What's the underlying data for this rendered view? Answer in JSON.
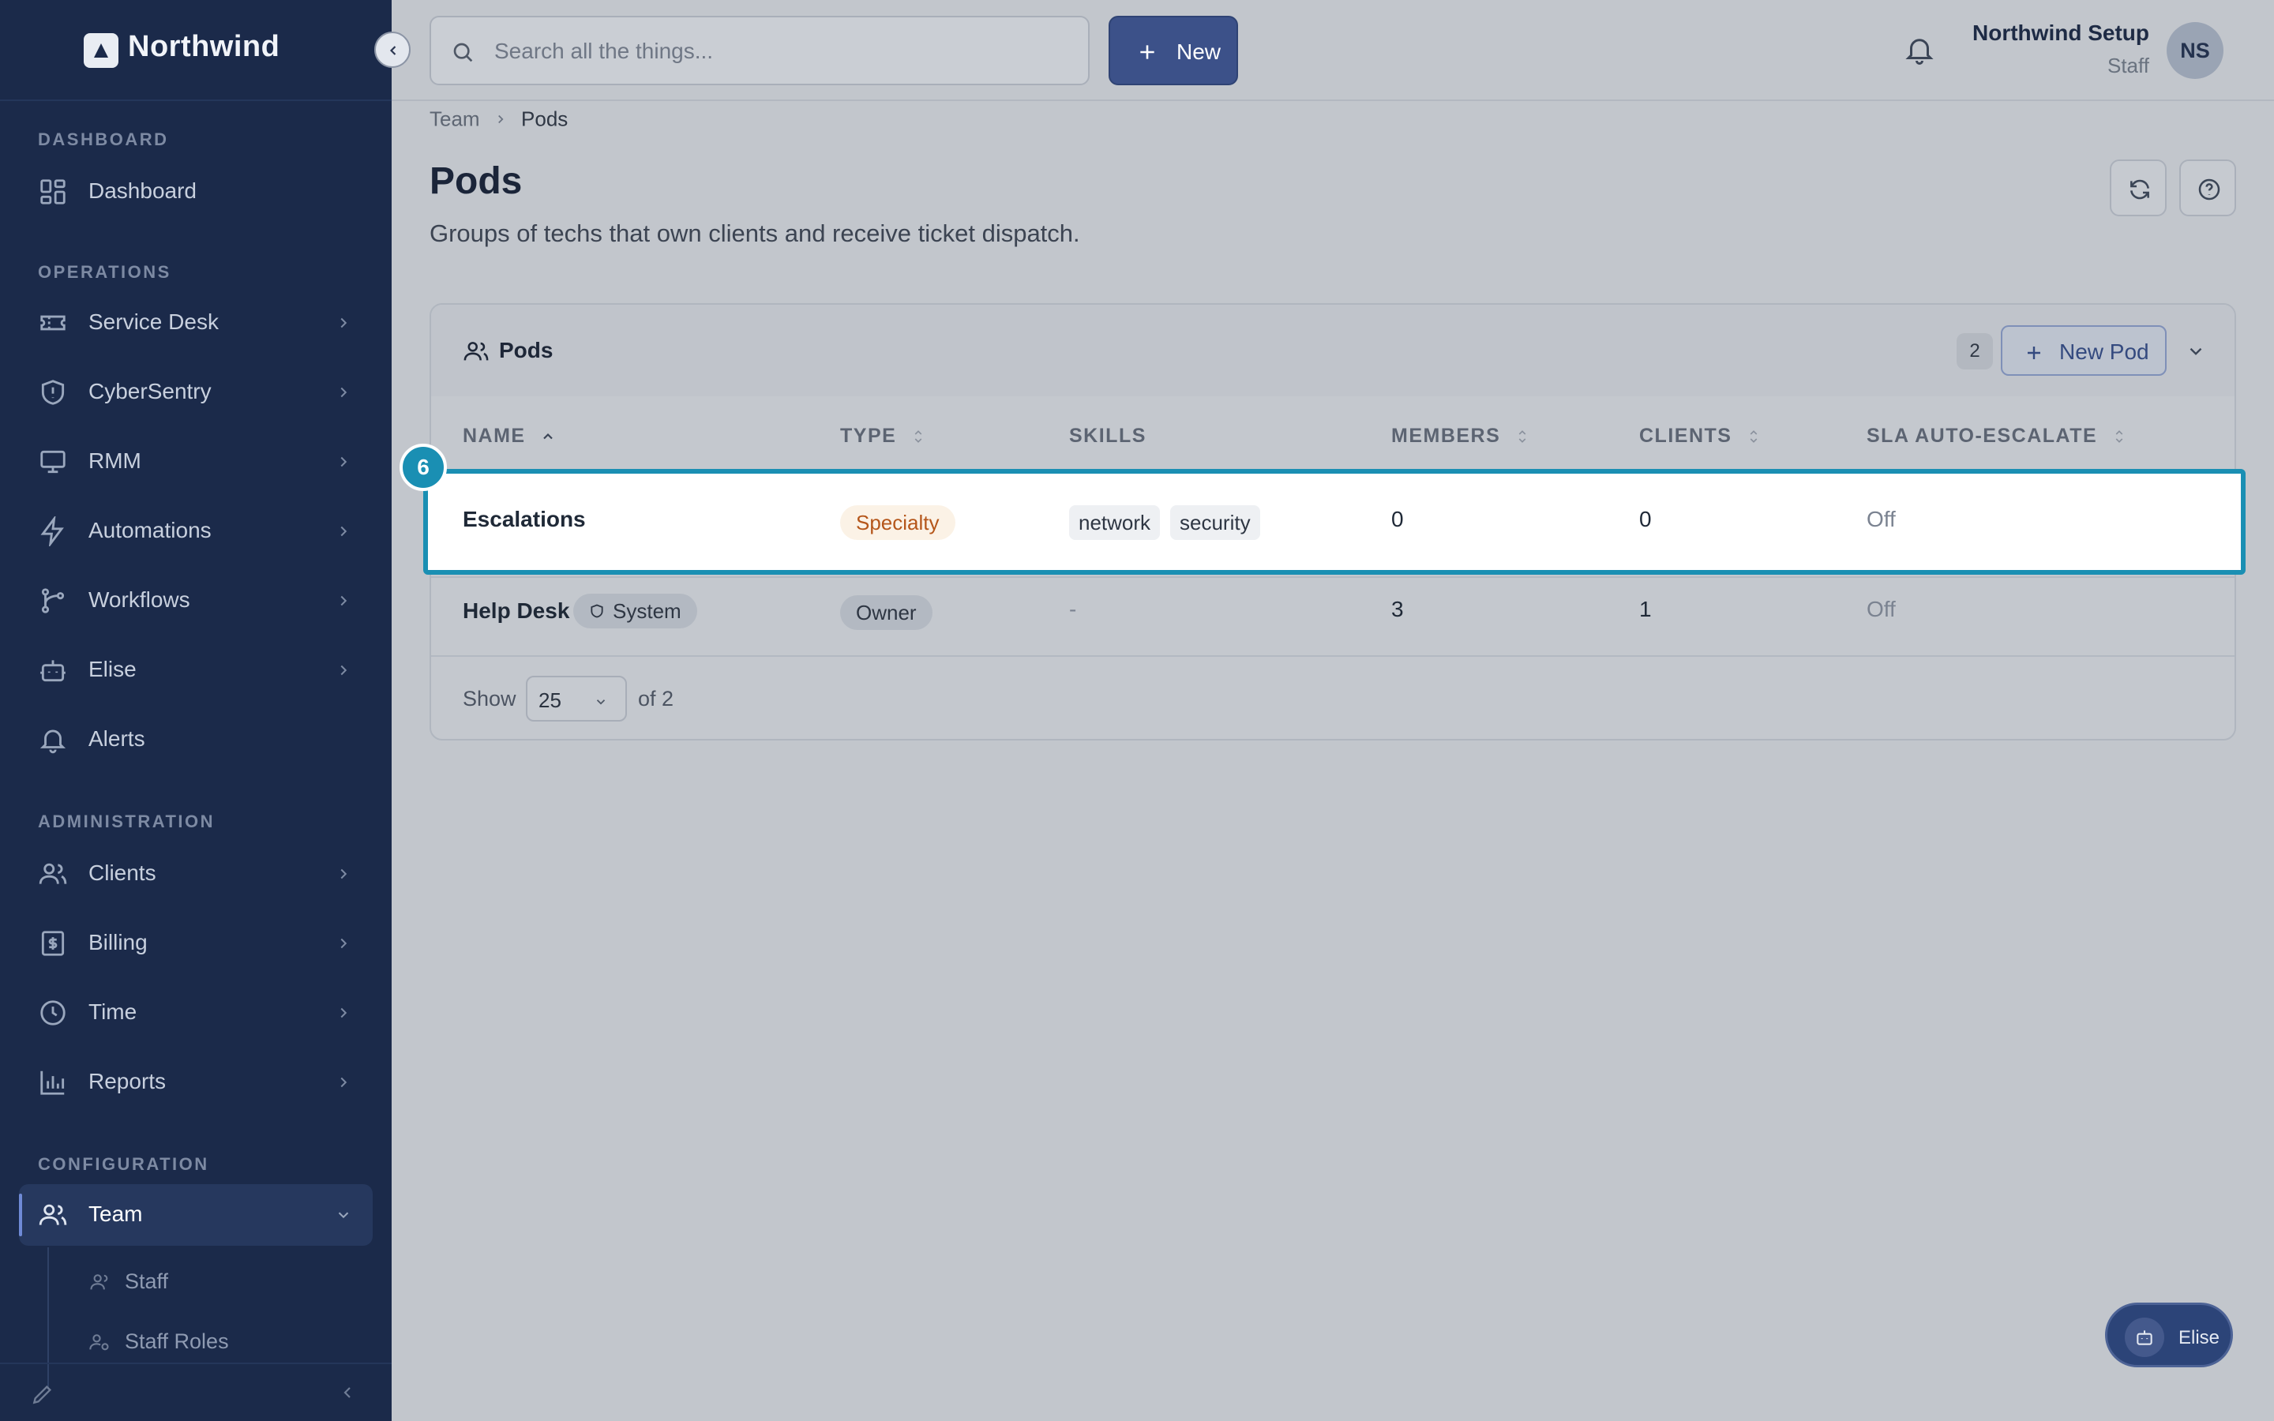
{
  "brand": {
    "name": "Northwind"
  },
  "sidebar": {
    "sections": {
      "dashboard": "DASHBOARD",
      "operations": "OPERATIONS",
      "administration": "ADMINISTRATION",
      "configuration": "CONFIGURATION"
    },
    "items": [
      {
        "label": "Dashboard"
      },
      {
        "label": "Service Desk"
      },
      {
        "label": "CyberSentry"
      },
      {
        "label": "RMM"
      },
      {
        "label": "Automations"
      },
      {
        "label": "Workflows"
      },
      {
        "label": "Elise"
      },
      {
        "label": "Alerts"
      },
      {
        "label": "Clients"
      },
      {
        "label": "Billing"
      },
      {
        "label": "Time"
      },
      {
        "label": "Reports"
      },
      {
        "label": "Team",
        "active": true
      }
    ],
    "sub_items": [
      {
        "label": "Staff"
      },
      {
        "label": "Staff Roles"
      }
    ]
  },
  "topbar": {
    "search_placeholder": "Search all the things...",
    "new_label": "New",
    "user_name": "Northwind Setup",
    "user_role": "Staff",
    "avatar_initials": "NS"
  },
  "breadcrumb": {
    "parent": "Team",
    "current": "Pods"
  },
  "page": {
    "title": "Pods",
    "subtitle": "Groups of techs that own clients and receive ticket dispatch."
  },
  "card": {
    "title": "Pods",
    "count": "2",
    "new_pod_label": "New Pod",
    "columns": {
      "name": "NAME",
      "type": "TYPE",
      "skills": "SKILLS",
      "members": "MEMBERS",
      "clients": "CLIENTS",
      "sla": "SLA AUTO-ESCALATE"
    },
    "rows": [
      {
        "name": "Escalations",
        "type": "Specialty",
        "skills": [
          "network",
          "security"
        ],
        "members": "0",
        "clients": "0",
        "sla": "Off"
      },
      {
        "name": "Help Desk",
        "badge": "System",
        "type": "Owner",
        "skills_text": "-",
        "members": "3",
        "clients": "1",
        "sla": "Off"
      }
    ],
    "footer": {
      "show_label": "Show",
      "page_size": "25",
      "of_label": "of 2"
    }
  },
  "step_badge": "6",
  "assistant": {
    "label": "Elise"
  },
  "colors": {
    "sidebar_bg": "#1b2a4a",
    "accent": "#3c5189",
    "highlight": "#1a8fb3",
    "specialty": "#b5561a"
  }
}
